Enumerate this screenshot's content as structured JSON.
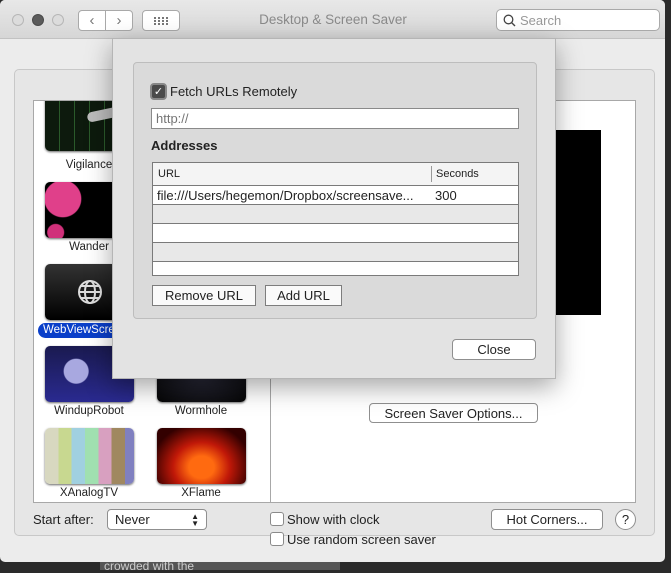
{
  "window": {
    "title": "Desktop & Screen Saver",
    "search_placeholder": "Search",
    "nav_back": "‹",
    "nav_forward": "›",
    "grid_icon": "grid-icon"
  },
  "savers": [
    {
      "name": "Vigilance"
    },
    {
      "name": "Wander"
    },
    {
      "name": "WebViewScreenSaver",
      "display": "WebViewScree",
      "selected": true
    },
    {
      "name": "WindupRobot"
    },
    {
      "name": "Wormhole"
    },
    {
      "name": "XAnalogTV"
    },
    {
      "name": "XFlame"
    }
  ],
  "pane": {
    "options_button": "Screen Saver Options..."
  },
  "dialog": {
    "fetch_label": "Fetch URLs Remotely",
    "fetch_checked": true,
    "url_placeholder": "http://",
    "url_value": "",
    "addresses_heading": "Addresses",
    "columns": [
      "URL",
      "Seconds"
    ],
    "rows": [
      {
        "url": "file:///Users/hegemon/Dropbox/screensave...",
        "seconds": "300"
      }
    ],
    "remove_button": "Remove URL",
    "add_button": "Add URL",
    "close_button": "Close"
  },
  "bottom": {
    "start_after_label": "Start after:",
    "start_after_value": "Never",
    "show_clock_label": "Show with clock",
    "show_clock_checked": false,
    "random_label": "Use random screen saver",
    "random_checked": false,
    "hot_corners_button": "Hot Corners...",
    "help_button": "?"
  },
  "background": {
    "text": "crowded with the"
  },
  "colors": {
    "selection": "#0a3fc9",
    "window_bg": "#ececec"
  }
}
